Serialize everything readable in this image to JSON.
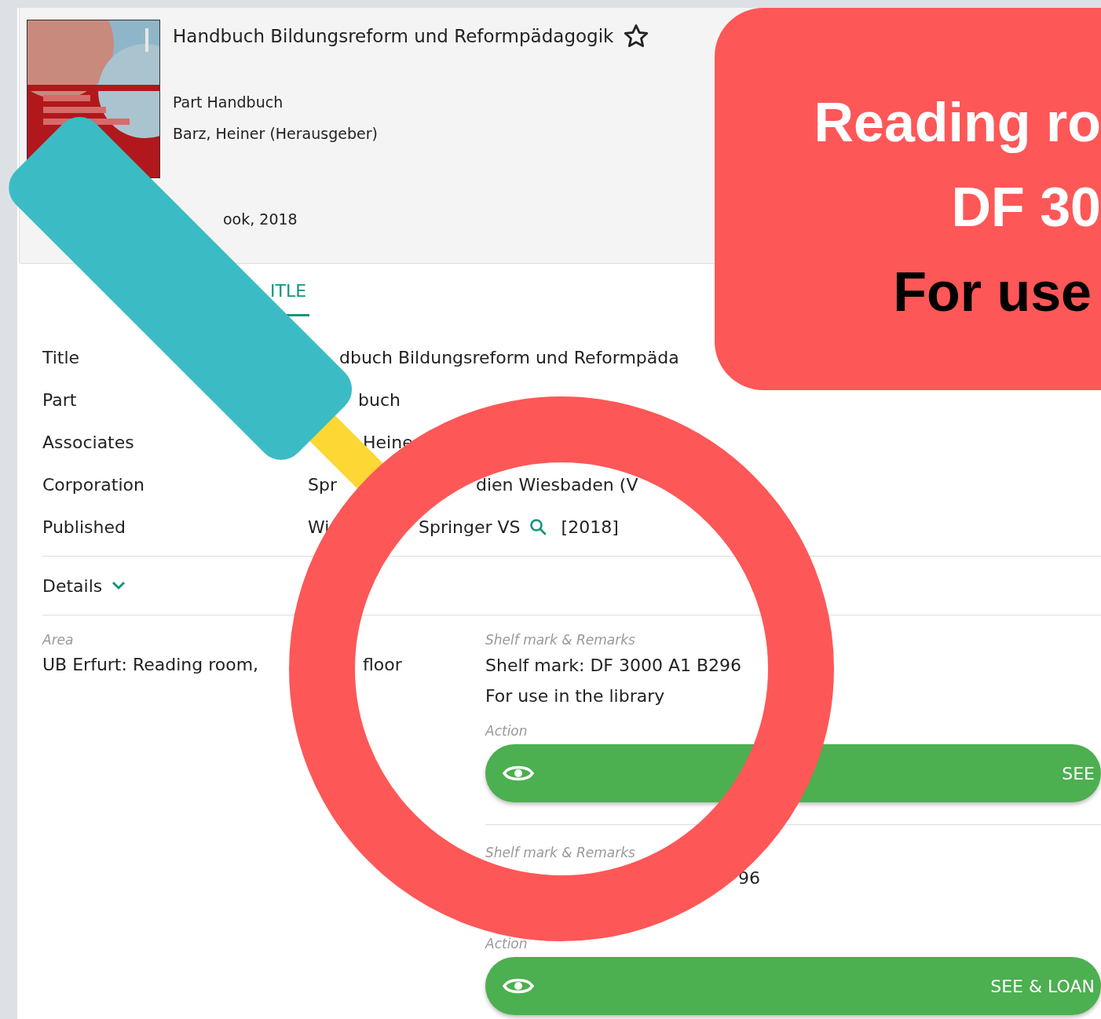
{
  "record": {
    "title": "Handbuch Bildungsreform und Reformpädagogik",
    "part": "Part Handbuch",
    "author": "Barz, Heiner (Herausgeber)",
    "format": "ook, 2018"
  },
  "tabs": [
    {
      "label": "ITLE",
      "selected": true
    }
  ],
  "fields": [
    {
      "label": "Title",
      "value": [
        "dbuch Bildungsreform und Reformpäda"
      ],
      "searchable": false
    },
    {
      "label": "Part",
      "value": [
        "buch"
      ],
      "searchable": false
    },
    {
      "label": "Associates",
      "value": [
        "Heine"
      ],
      "searchable": false
    },
    {
      "label": "Corporation",
      "value": [
        "Spr",
        "dien Wiesbaden (V"
      ],
      "searchable": false
    },
    {
      "label": "Published",
      "value": [
        "Wi",
        "Springer VS"
      ],
      "searchable": true,
      "date": "[2018]"
    }
  ],
  "details": {
    "label": "Details",
    "expanded": false
  },
  "holdings": {
    "area_label": "Area",
    "area_value": [
      "UB Erfurt: Reading room,",
      "floor"
    ],
    "items": [
      {
        "shelf_label": "Shelf mark & Remarks",
        "shelf_lines": [
          "Shelf mark: DF 3000 A1 B296",
          "For use in the library"
        ],
        "action_label": "Action",
        "action": "SEE"
      },
      {
        "shelf_label": "Shelf mark & Remarks",
        "shelf_lines": [
          "96"
        ],
        "action_label": "Action",
        "action": "SEE & LOAN"
      }
    ]
  },
  "callout": {
    "lines": [
      {
        "text": "Reading ro",
        "kind": "light"
      },
      {
        "text": "DF 30",
        "kind": "light"
      },
      {
        "text": "For use",
        "kind": "dark"
      }
    ]
  }
}
